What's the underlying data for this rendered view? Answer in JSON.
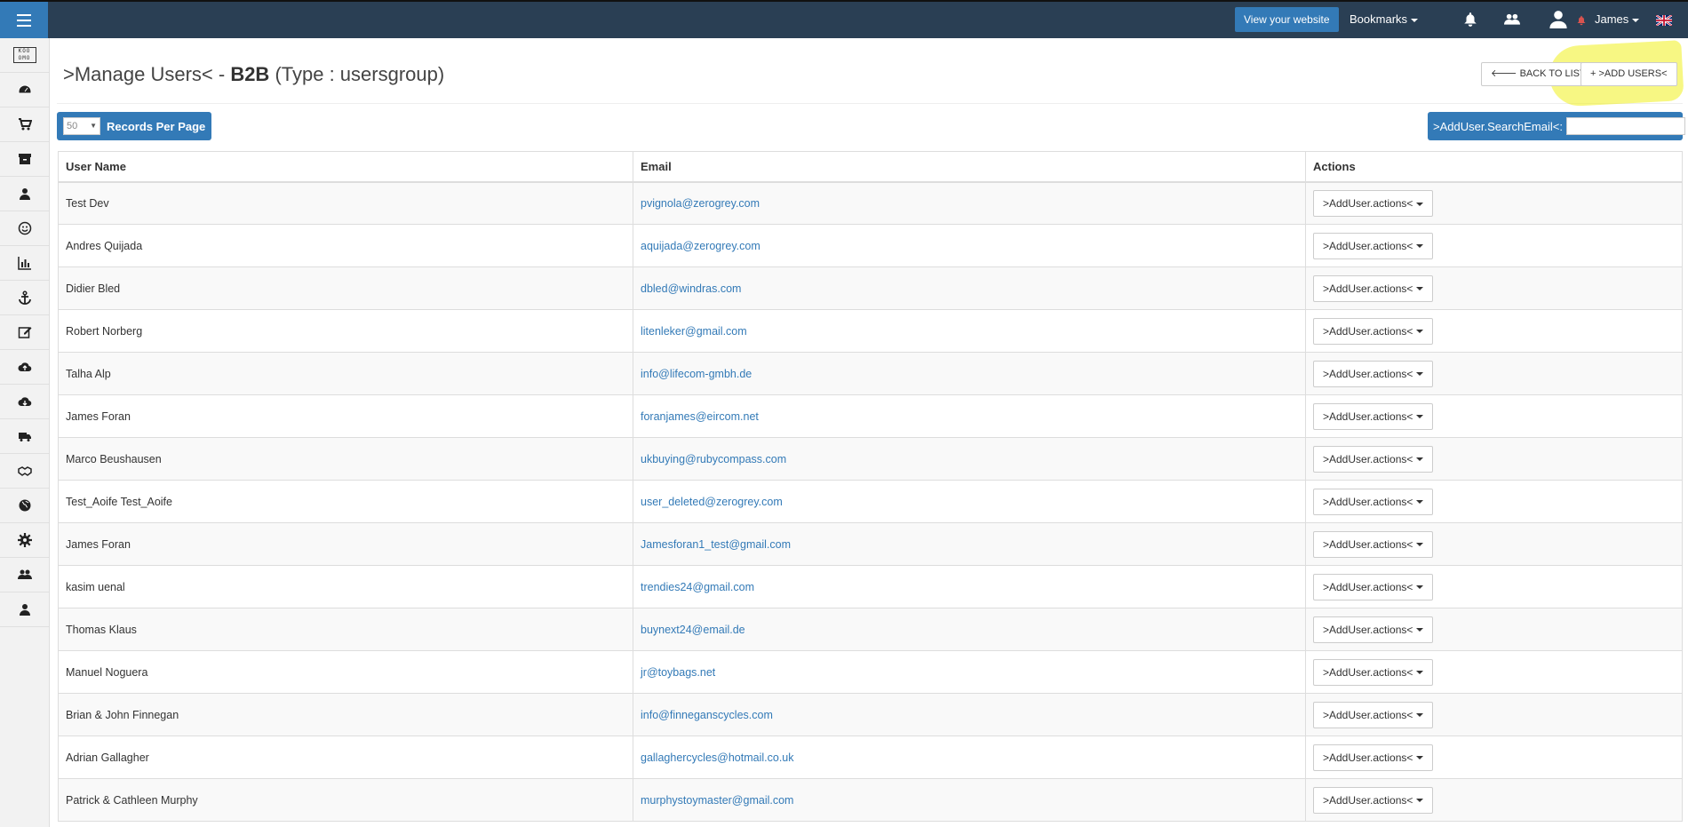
{
  "topbar": {
    "view_website": "View your website",
    "bookmarks": "Bookmarks",
    "user": "James"
  },
  "sidebar": {
    "logo": "KOO OMO",
    "items": [
      "dashboard-icon",
      "cart-icon",
      "archive-icon",
      "user-icon",
      "smile-icon",
      "chart-icon",
      "anchor-icon",
      "edit-icon",
      "cloud-upload-icon",
      "cloud-download-icon",
      "truck-icon",
      "handshake-icon",
      "globe-icon",
      "gear-icon",
      "users-icon",
      "user-icon"
    ]
  },
  "header": {
    "title_prefix": ">Manage Users< - ",
    "title_bold": "B2B",
    "title_suffix": " (Type : usersgroup)",
    "back_button": "BACK TO LIST",
    "add_button": ">ADD USERS<"
  },
  "toolbar": {
    "records_value": "50",
    "records_label": "Records Per Page",
    "search_label": ">AddUser.SearchEmail<:",
    "search_value": ""
  },
  "table": {
    "columns": [
      "User Name",
      "Email",
      "Actions"
    ],
    "action_label": ">AddUser.actions<",
    "rows": [
      {
        "name": "Test Dev",
        "email": "pvignola@zerogrey.com"
      },
      {
        "name": "Andres Quijada",
        "email": "aquijada@zerogrey.com"
      },
      {
        "name": "Didier Bled",
        "email": "dbled@windras.com"
      },
      {
        "name": "Robert Norberg",
        "email": "litenleker@gmail.com"
      },
      {
        "name": "Talha Alp",
        "email": "info@lifecom-gmbh.de"
      },
      {
        "name": "James Foran",
        "email": "foranjames@eircom.net"
      },
      {
        "name": "Marco Beushausen",
        "email": "ukbuying@rubycompass.com"
      },
      {
        "name": "Test_Aoife Test_Aoife",
        "email": "user_deleted@zerogrey.com"
      },
      {
        "name": "James Foran",
        "email": "Jamesforan1_test@gmail.com"
      },
      {
        "name": "kasim uenal",
        "email": "trendies24@gmail.com"
      },
      {
        "name": "Thomas Klaus",
        "email": "buynext24@email.de"
      },
      {
        "name": "Manuel Noguera",
        "email": "jr@toybags.net"
      },
      {
        "name": "Brian & John Finnegan",
        "email": "info@finneganscycles.com"
      },
      {
        "name": "Adrian Gallagher",
        "email": "gallaghercycles@hotmail.co.uk"
      },
      {
        "name": "Patrick & Cathleen Murphy",
        "email": "murphystoymaster@gmail.com"
      }
    ]
  },
  "colors": {
    "topbar": "#2a3f54",
    "primary": "#337ab7",
    "highlight": "#f0f01e"
  }
}
